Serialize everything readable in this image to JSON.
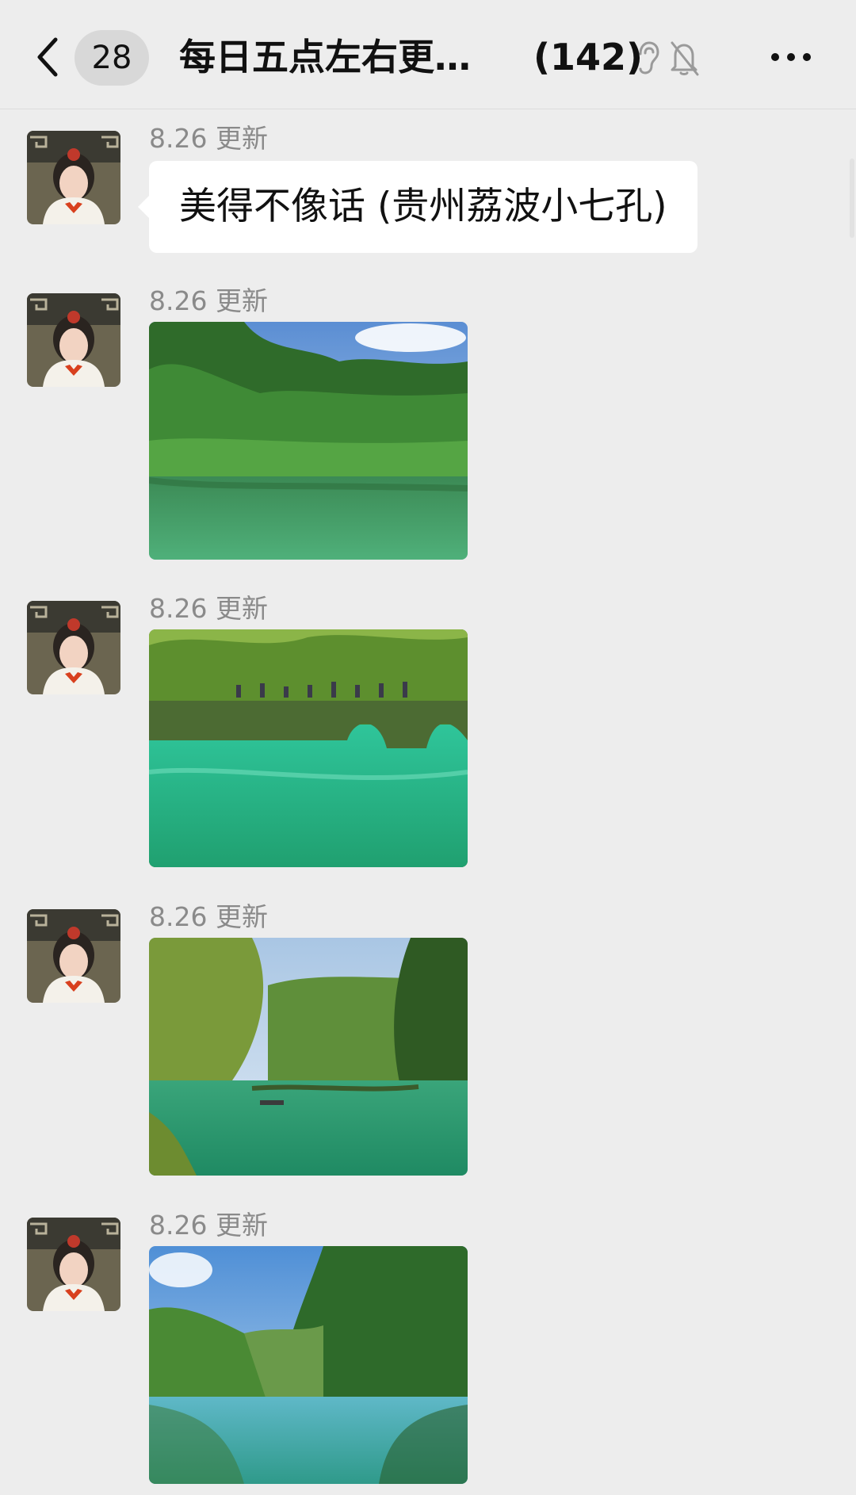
{
  "header": {
    "unread_count": "28",
    "title": "每日五点左右更…",
    "member_count": "(142)"
  },
  "messages": [
    {
      "type": "text",
      "sender": "8.26 更新",
      "text": "美得不像话 (贵州荔波小七孔)"
    },
    {
      "type": "image",
      "sender": "8.26 更新",
      "image": "forest-lake-photo"
    },
    {
      "type": "image",
      "sender": "8.26 更新",
      "image": "stone-bridge-photo"
    },
    {
      "type": "image",
      "sender": "8.26 更新",
      "image": "bamboo-river-photo"
    },
    {
      "type": "image",
      "sender": "8.26 更新",
      "image": "river-valley-photo"
    }
  ],
  "colors": {
    "background": "#ededed",
    "bubble": "#ffffff",
    "sender_text": "#8a8a8a"
  },
  "icons": [
    "chevron-left-icon",
    "ear-icon",
    "bell-off-icon",
    "more-icon"
  ]
}
